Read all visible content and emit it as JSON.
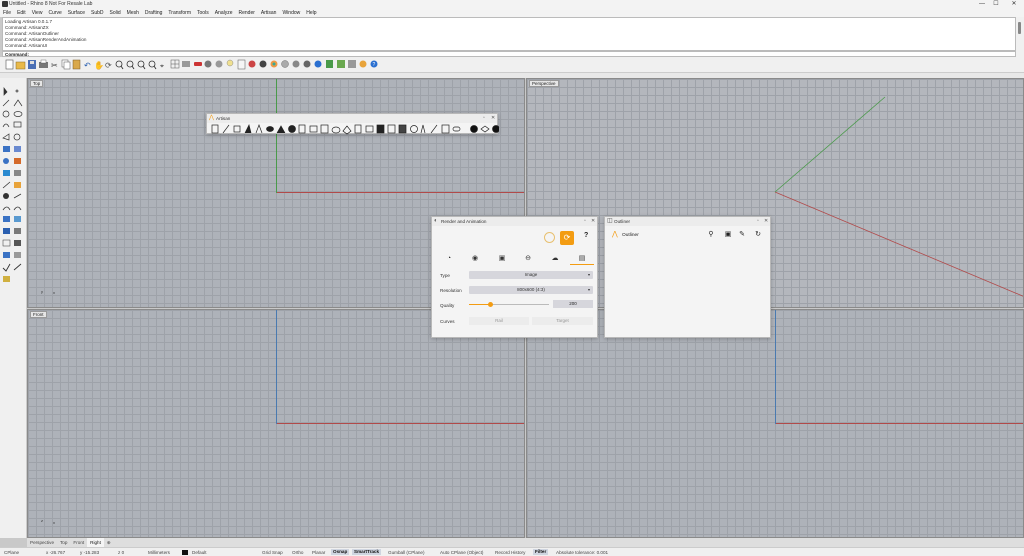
{
  "window": {
    "title": "Untitled - Rhino 8 Not For Resale Lab",
    "minimize": "—",
    "maximize": "☐",
    "close": "✕"
  },
  "menu": [
    "File",
    "Edit",
    "View",
    "Curve",
    "Surface",
    "SubD",
    "Solid",
    "Mesh",
    "Drafting",
    "Transform",
    "Tools",
    "Analyze",
    "Render",
    "Artisan",
    "Window",
    "Help"
  ],
  "command_history": [
    "Loading Artisan 0.0.1.7",
    "Command: ArtisanZX",
    "Command: ArtisanOutliner",
    "Command: ArtisanRenderAndAnimation",
    "Command: ArtisanUI"
  ],
  "command_prompt": "Command:",
  "viewports": {
    "top": "Top",
    "perspective": "Perspective",
    "front": "Front"
  },
  "axis_labels": {
    "x": "x",
    "y": "y",
    "z": "z"
  },
  "artisan_toolbar": {
    "title": "Artisan"
  },
  "render_panel": {
    "title": "Render and Animation",
    "help": "?",
    "type_label": "Type",
    "type_value": "Image",
    "resolution_label": "Resolution",
    "resolution_value": "800x600 (4:3)",
    "quality_label": "Quality",
    "quality_value": "200",
    "quality_fraction": 0.27,
    "curves_label": "Curves",
    "curves_left": "Rail",
    "curves_right": "Target"
  },
  "outliner": {
    "title": "Outliner",
    "item": "Outliner"
  },
  "bottom_tabs": [
    "Perspective",
    "Top",
    "Front",
    "Right"
  ],
  "bottom_tabs_active": "Right",
  "status": {
    "cplane": "CPlane",
    "x": "x -26.767",
    "y": "y -15.283",
    "z": "z 0",
    "units": "Millimeters",
    "layer": "Default",
    "gridsnap": "Grid Snap",
    "ortho": "Ortho",
    "planar": "Planar",
    "osnap": "Osnap",
    "smarttrack": "SmartTrack",
    "gumball": "Gumball (CPlane)",
    "autocplane": "Auto CPlane (Object)",
    "history": "Record History",
    "filter": "Filter",
    "tolerance": "Absolute tolerance: 0.001"
  },
  "colors": {
    "accent": "#f39c12",
    "viewport_bg": "#aeb2b9",
    "axis_x": "#b14a4a",
    "axis_y": "#4a9a4a"
  }
}
